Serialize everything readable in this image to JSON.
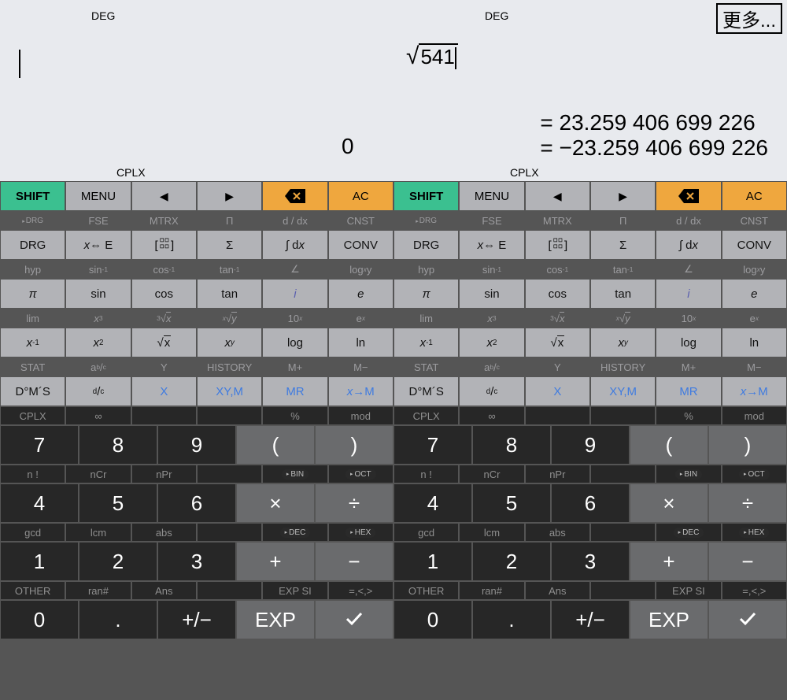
{
  "top": {
    "more": "更多...",
    "deg": "DEG",
    "cplx": "CPLX",
    "sqrt_val": "541",
    "zero": "0",
    "result1": "= 23.259 406 699 226",
    "result2": "= −23.259 406 699 226"
  },
  "row1": {
    "shift": "SHIFT",
    "menu": "MENU",
    "ac": "AC"
  },
  "shiftRows": {
    "r1": [
      "▸DRG",
      "FSE",
      "MTRX",
      "Π",
      "d / dx",
      "CNST"
    ],
    "r2": [
      "hyp",
      "sin⁻¹",
      "cos⁻¹",
      "tan⁻¹",
      "∠",
      "logₓ y"
    ],
    "r3": [
      "lim",
      "x³",
      "³√x",
      "ˣ√y",
      "10ˣ",
      "eˣ"
    ],
    "r4": [
      "STAT",
      "a ᵇ/c",
      "Y",
      "HISTORY",
      "M+",
      "M−"
    ],
    "r5": [
      "CPLX",
      "∞",
      "",
      "",
      "%",
      "mod"
    ],
    "r6": [
      "n !",
      "nCr",
      "nPr",
      "",
      "▸BIN",
      "▸OCT"
    ],
    "r7": [
      "gcd",
      "lcm",
      "abs",
      "",
      "▸DEC",
      "▸HEX"
    ],
    "r8": [
      "OTHER",
      "ran#",
      "Ans",
      "",
      "EXP SI",
      "=,<,>"
    ]
  },
  "mainRows": {
    "r1": [
      "DRG",
      "x ⇔ E",
      "[▯▯]",
      "Σ",
      "∫ dx",
      "CONV"
    ],
    "r2": [
      "π",
      "sin",
      "cos",
      "tan",
      "i",
      "e"
    ],
    "r3": [
      "x⁻¹",
      "x²",
      "√x",
      "xʸ",
      "log",
      "ln"
    ],
    "r4": [
      "D°M´S",
      "ᵈ/c",
      "X",
      "XY,M",
      "MR",
      "x→M"
    ]
  },
  "numRows": {
    "r1": [
      "7",
      "8",
      "9",
      "(",
      ")"
    ],
    "r2": [
      "4",
      "5",
      "6",
      "×",
      "÷"
    ],
    "r3": [
      "1",
      "2",
      "3",
      "+",
      "−"
    ],
    "r4": [
      "0",
      ".",
      "+/−",
      "EXP",
      "✓"
    ]
  }
}
